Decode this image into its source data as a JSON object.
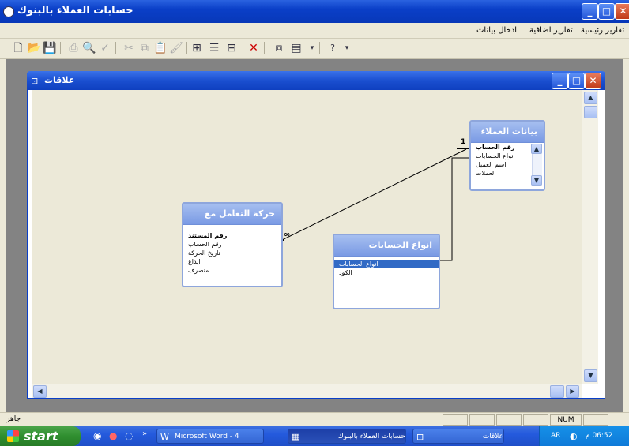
{
  "window": {
    "title": "حسابات العملاء بالبنوك",
    "controls": [
      "minimize",
      "maximize",
      "close"
    ]
  },
  "menu": {
    "items": [
      "تقارير رئيسية",
      "تقارير اضافية",
      "ادخال بيانات"
    ]
  },
  "toolbar": {
    "icons": [
      "new-icon",
      "open-icon",
      "save-icon",
      "print-icon",
      "print-preview-icon",
      "spell-icon",
      "cut-icon",
      "copy-icon",
      "paste-icon",
      "format-painter-icon",
      "show-table-icon",
      "properties-icon",
      "relationships-icon",
      "delete-icon",
      "new-object-icon",
      "office-links-icon",
      "help-icon"
    ]
  },
  "child_window": {
    "title": "علاقات",
    "tables": [
      {
        "title": "بيانات العملاء",
        "fields": [
          "رقم الحساب",
          "نواع الحسابات",
          "اسم العميل",
          "العملات"
        ],
        "key_index": 0
      },
      {
        "title": "حركة التعامل مع",
        "fields": [
          "رقم المستند",
          "رقم الحساب",
          "تاريخ الحركة",
          "ايداع",
          "منصرف"
        ],
        "key_index": 0
      },
      {
        "title": "انواع الحسابات",
        "fields": [
          "انواع الحسابات",
          "الكود"
        ],
        "selected_index": 0
      }
    ],
    "relations": [
      {
        "one_label": "1",
        "many_label": "∞"
      }
    ]
  },
  "statusbar": {
    "left": "جاهز",
    "num": "NUM"
  },
  "taskbar": {
    "start_label": "start",
    "tasks": [
      "Microsoft Word - 4",
      "حسابات العملاء بالبنوك",
      "علاقات"
    ],
    "tray_lang": "AR",
    "time": "06:52 م"
  },
  "colors": {
    "titlebar": "#0a3fc8",
    "taskbar": "#245add",
    "start": "#2f8e2f",
    "table_header": "#8aa8ea"
  }
}
